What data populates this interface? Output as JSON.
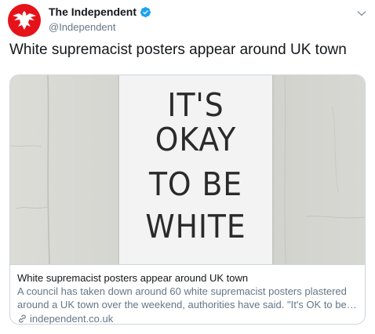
{
  "tweet": {
    "author": {
      "name": "The Independent",
      "handle": "@Independent",
      "verified": true,
      "avatar_icon": "eagle-logo-icon",
      "avatar_color": "#e6121a"
    },
    "text": "White supremacist posters appear around UK town",
    "menu_icon": "chevron-down-icon"
  },
  "card": {
    "image": {
      "poster_lines": [
        "IT'S",
        "OKAY",
        "TO BE",
        "WHITE"
      ]
    },
    "title": "White supremacist posters appear around UK town",
    "description": "A council has taken down around 60 white supremacist posters plastered around a UK town over the weekend, authorities have said.  \"It's OK to be white\" and \"reje...",
    "domain": "independent.co.uk",
    "link_icon": "link-icon"
  },
  "colors": {
    "verified_blue": "#1da1f2",
    "secondary_text": "#657786",
    "border": "#ccd6dd"
  }
}
